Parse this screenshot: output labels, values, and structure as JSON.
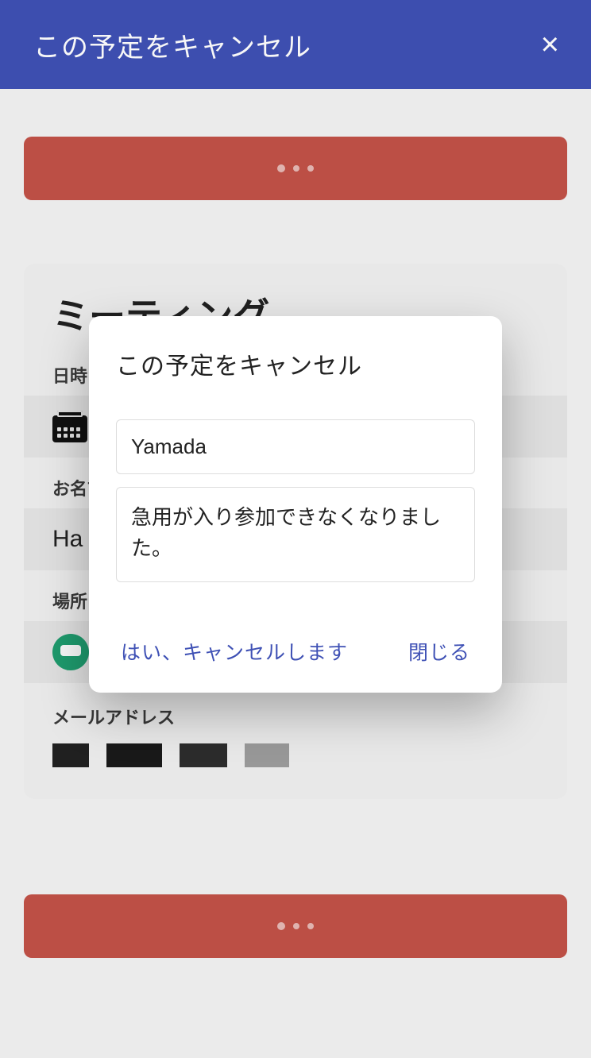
{
  "header": {
    "title": "この予定をキャンセル",
    "close_icon": "×"
  },
  "event": {
    "title": "ミーティング",
    "labels": {
      "datetime": "日時",
      "name": "お名前",
      "place": "場所",
      "email": "メールアドレス"
    },
    "name_value_prefix": "Ha"
  },
  "modal": {
    "title": "この予定をキャンセル",
    "name_value": "Yamada",
    "reason_value": "急用が入り参加できなくなりました。",
    "confirm_label": "はい、キャンセルします",
    "close_label": "閉じる"
  }
}
